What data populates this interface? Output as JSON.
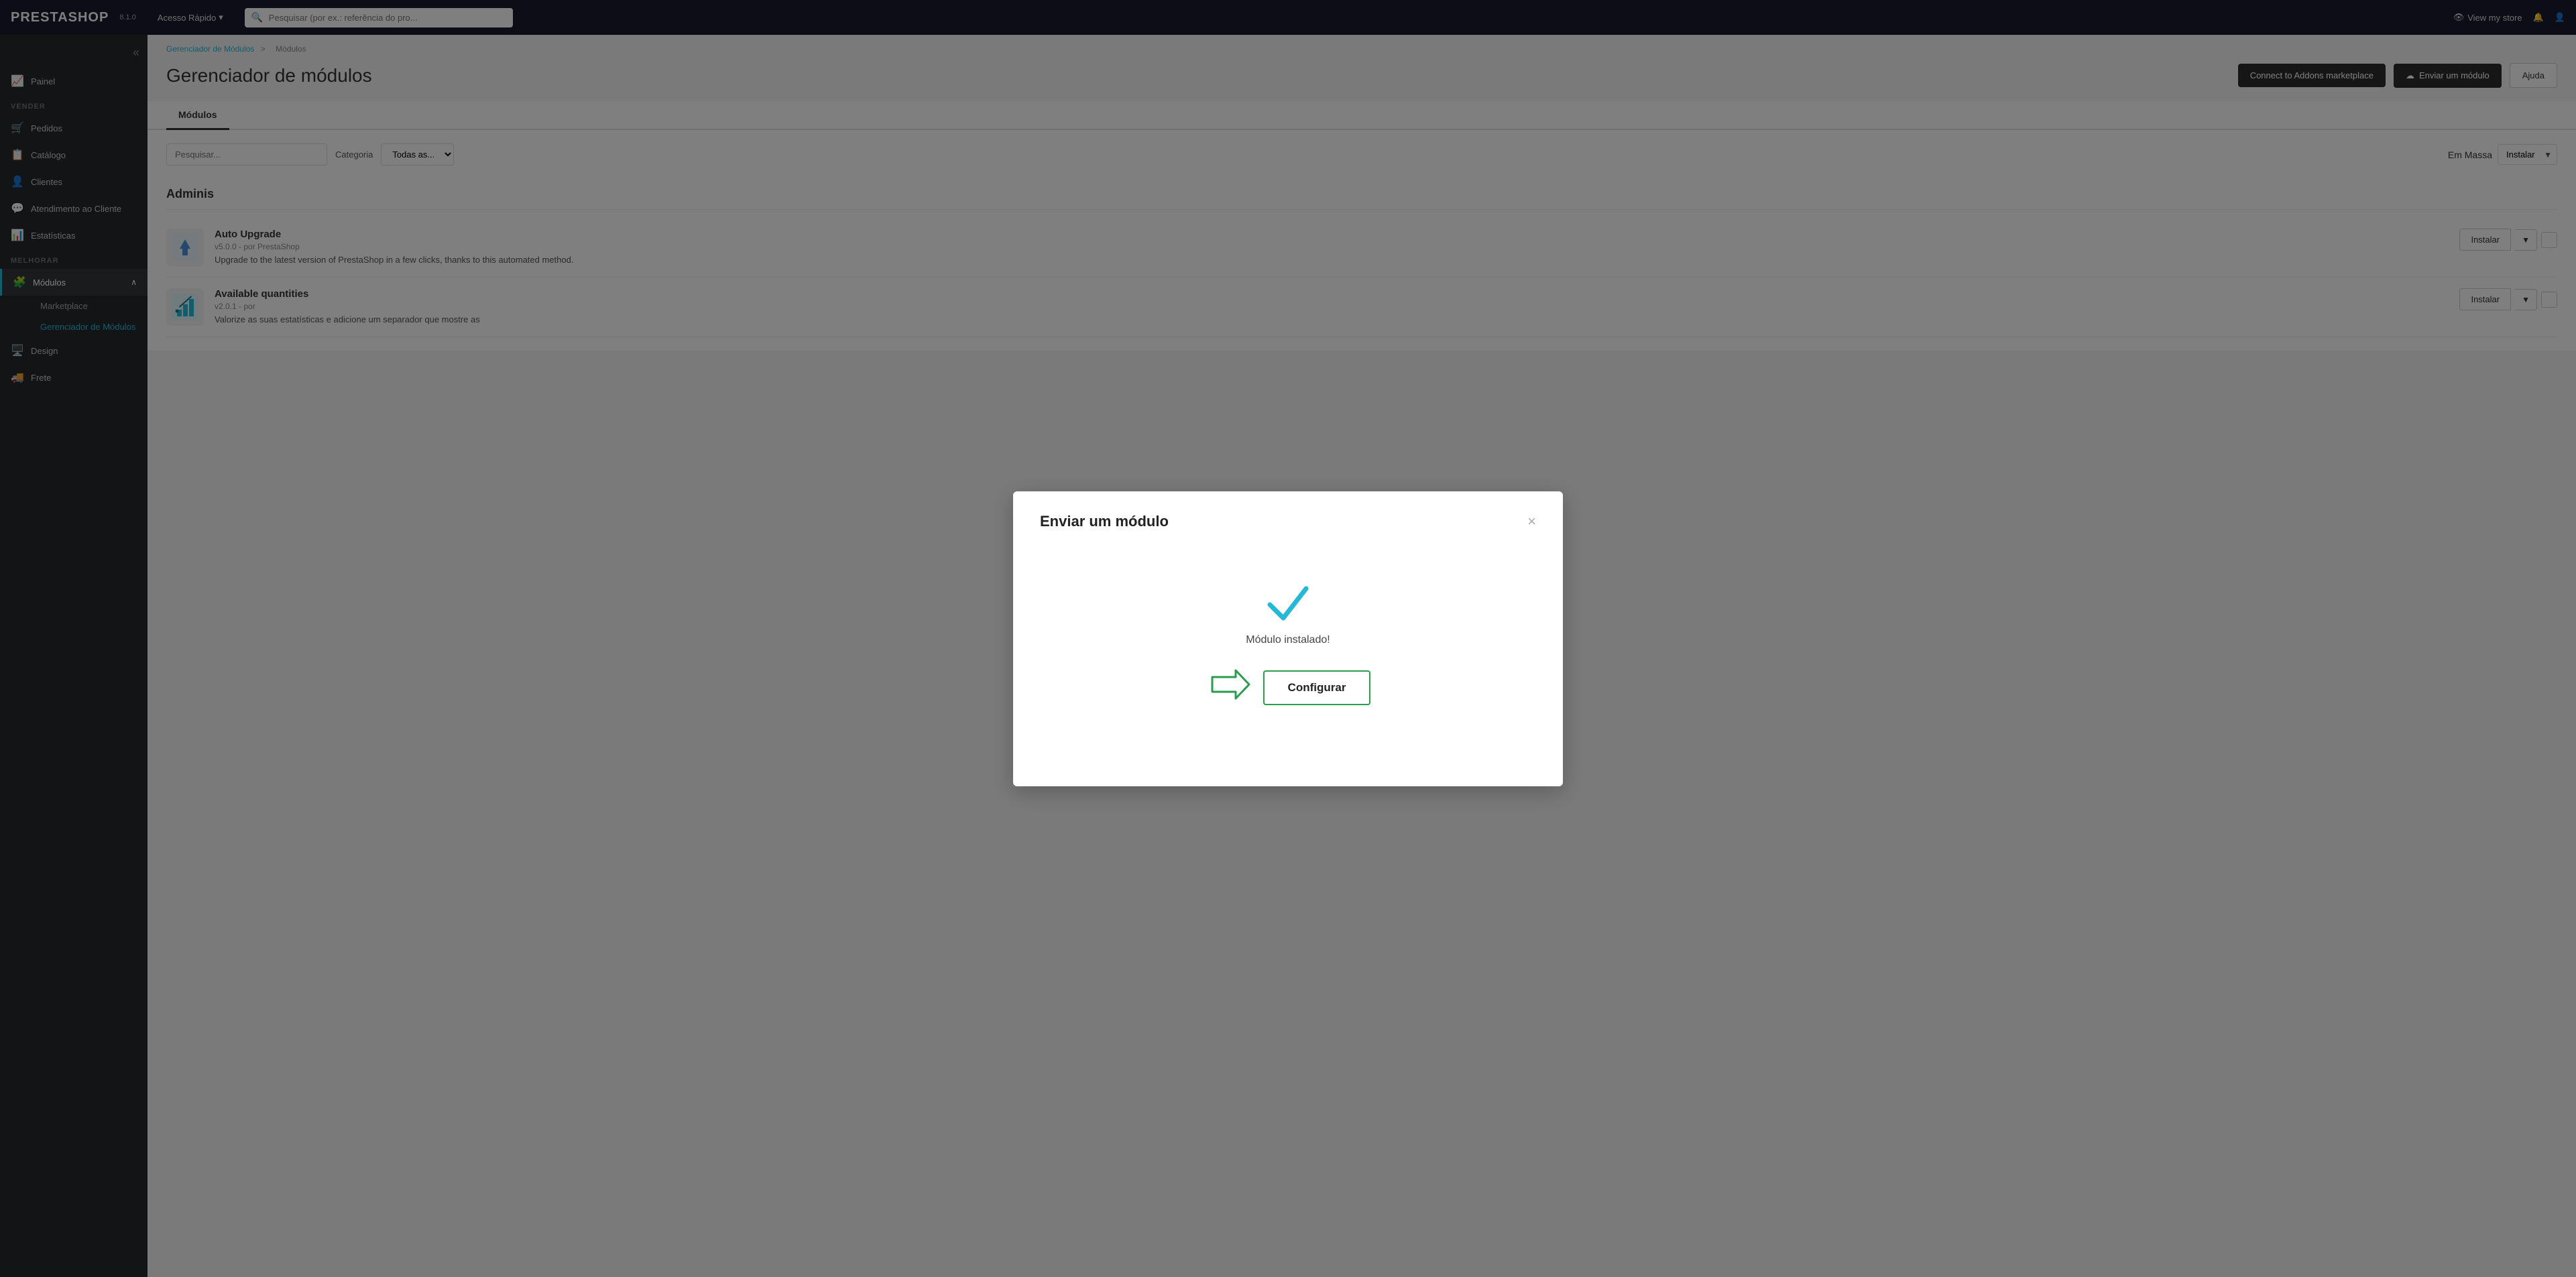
{
  "topnav": {
    "logo": "PRESTASHOP",
    "version": "8.1.0",
    "rapid_label": "Acesso Rápido",
    "search_placeholder": "Pesquisar (por ex.: referência do pro...",
    "view_store_label": "View my store",
    "rapid_icon": "▾"
  },
  "sidebar": {
    "toggle_icon": "«",
    "sections": [
      {
        "label": "",
        "items": [
          {
            "id": "painel",
            "label": "Painel",
            "icon": "📈"
          }
        ]
      },
      {
        "label": "VENDER",
        "items": [
          {
            "id": "pedidos",
            "label": "Pedidos",
            "icon": "🛒"
          },
          {
            "id": "catalogo",
            "label": "Catálogo",
            "icon": "📋"
          },
          {
            "id": "clientes",
            "label": "Clientes",
            "icon": "👤"
          },
          {
            "id": "atendimento",
            "label": "Atendimento ao Cliente",
            "icon": "💬"
          },
          {
            "id": "estatisticas",
            "label": "Estatísticas",
            "icon": "📊"
          }
        ]
      },
      {
        "label": "MELHORAR",
        "items": [
          {
            "id": "modulos",
            "label": "Módulos",
            "icon": "🧩",
            "expanded": true
          },
          {
            "id": "design",
            "label": "Design",
            "icon": "🖥️"
          }
        ]
      }
    ],
    "modulos_sub": [
      {
        "id": "marketplace",
        "label": "Marketplace"
      },
      {
        "id": "gerenciador",
        "label": "Gerenciador de Módulos",
        "active": true
      }
    ]
  },
  "breadcrumb": {
    "parent": "Gerenciador de Módulos",
    "separator": ">",
    "current": "Módulos"
  },
  "page": {
    "title": "Gerenciador de módulos",
    "btn_connect": "Connect to Addons marketplace",
    "btn_upload": "Enviar um módulo",
    "btn_help": "Ajuda",
    "upload_icon": "☁"
  },
  "tabs": [
    {
      "id": "modulos",
      "label": "Módulos",
      "active": true
    }
  ],
  "filter": {
    "search_placeholder": "Pesquisar...",
    "category_label": "Categoria",
    "all_categories": "Todas as...",
    "mass_actions_label": "Em Massa",
    "mass_action_option": "Instalar"
  },
  "module_section": {
    "title": "Adminis"
  },
  "modules": [
    {
      "id": "module-1",
      "icon_type": "upgrade",
      "name": "Auto Upgrade",
      "meta": "v5.0.0 - por PrestaShop",
      "desc": "Upgrade to the latest version of PrestaShop in a few clicks, thanks to this automated method.",
      "action": "Instalar"
    },
    {
      "id": "module-2",
      "icon_type": "quantities",
      "name": "Available quantities",
      "meta": "v2.0.1 - por",
      "desc": "Valorize as suas estatísticas e adicione um separador que mostre as",
      "action": "Instalar"
    }
  ],
  "modal": {
    "title": "Enviar um módulo",
    "close_icon": "×",
    "success_text": "Módulo instalado!",
    "configure_label": "Configurar"
  }
}
